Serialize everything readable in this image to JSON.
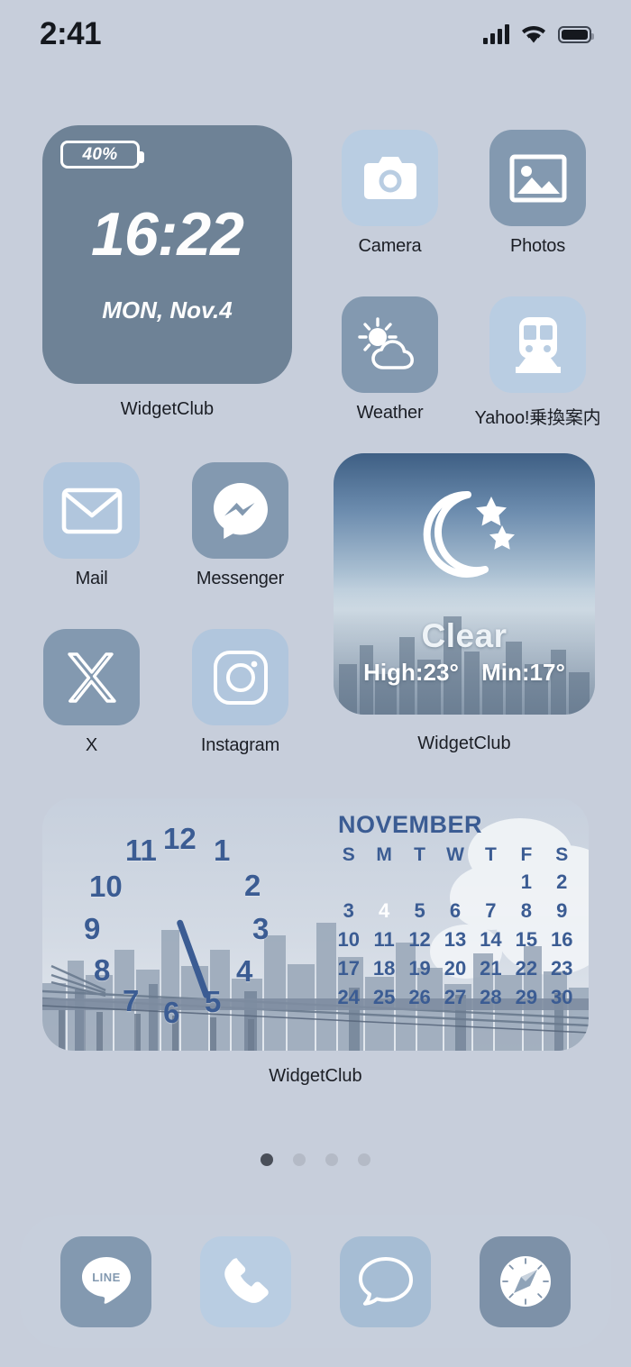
{
  "status_bar": {
    "time": "2:41",
    "signal_icon": "cellular-bars-icon",
    "wifi_icon": "wifi-icon",
    "battery_icon": "battery-full-icon"
  },
  "clock_widget": {
    "battery_percent": "40%",
    "time": "16:22",
    "date": "MON, Nov.4",
    "label": "WidgetClub",
    "bg_color": "#6e8296"
  },
  "weather_widget": {
    "icon": "moon-stars-icon",
    "condition": "Clear",
    "high": "High:23°",
    "low": "Min:17°",
    "label": "WidgetClub"
  },
  "big_widget": {
    "label": "WidgetClub",
    "analog_clock": {
      "numbers": [
        "12",
        "1",
        "2",
        "3",
        "4",
        "5",
        "6",
        "7",
        "8",
        "9",
        "10",
        "11"
      ],
      "hand_angle_deg": 160,
      "number_color": "#3b5c93"
    },
    "calendar": {
      "month": "NOVEMBER",
      "weekdays": [
        "S",
        "M",
        "T",
        "W",
        "T",
        "F",
        "S"
      ],
      "weeks": [
        [
          "",
          "",
          "",
          "",
          "",
          "1",
          "2"
        ],
        [
          "3",
          "4",
          "5",
          "6",
          "7",
          "8",
          "9"
        ],
        [
          "10",
          "11",
          "12",
          "13",
          "14",
          "15",
          "16"
        ],
        [
          "17",
          "18",
          "19",
          "20",
          "21",
          "22",
          "23"
        ],
        [
          "24",
          "25",
          "26",
          "27",
          "28",
          "29",
          "30"
        ]
      ],
      "today": "4",
      "today_color": "#2f4d85",
      "text_color": "#3b5c93"
    }
  },
  "apps": [
    {
      "name": "Camera",
      "label": "Camera",
      "icon": "camera-icon",
      "bg": "#b9cde2"
    },
    {
      "name": "Photos",
      "label": "Photos",
      "icon": "photos-icon",
      "bg": "#8399b0"
    },
    {
      "name": "Weather",
      "label": "Weather",
      "icon": "weather-icon",
      "bg": "#8399b0"
    },
    {
      "name": "Yahoo Transit",
      "label": "Yahoo!乗換案内",
      "icon": "train-icon",
      "bg": "#b9cde2"
    },
    {
      "name": "Mail",
      "label": "Mail",
      "icon": "mail-icon",
      "bg": "#b1c6dd"
    },
    {
      "name": "Messenger",
      "label": "Messenger",
      "icon": "messenger-icon",
      "bg": "#8399b0"
    },
    {
      "name": "X",
      "label": "X",
      "icon": "x-logo-icon",
      "bg": "#8399b0"
    },
    {
      "name": "Instagram",
      "label": "Instagram",
      "icon": "instagram-icon",
      "bg": "#b1c6dd"
    }
  ],
  "page_dots": {
    "count": 4,
    "active_index": 0
  },
  "dock": [
    {
      "name": "LINE",
      "icon": "line-icon",
      "bg": "#8399b0",
      "text": "LINE"
    },
    {
      "name": "Phone",
      "icon": "phone-icon",
      "bg": "#b9cde2"
    },
    {
      "name": "Messages",
      "icon": "messages-icon",
      "bg": "#a6bdd4"
    },
    {
      "name": "Safari",
      "icon": "safari-icon",
      "bg": "#7d91a8"
    }
  ],
  "theme": {
    "wallpaper": "#c7cedb",
    "label_color": "#1b1e25",
    "accent_blue": "#3b5c93"
  }
}
